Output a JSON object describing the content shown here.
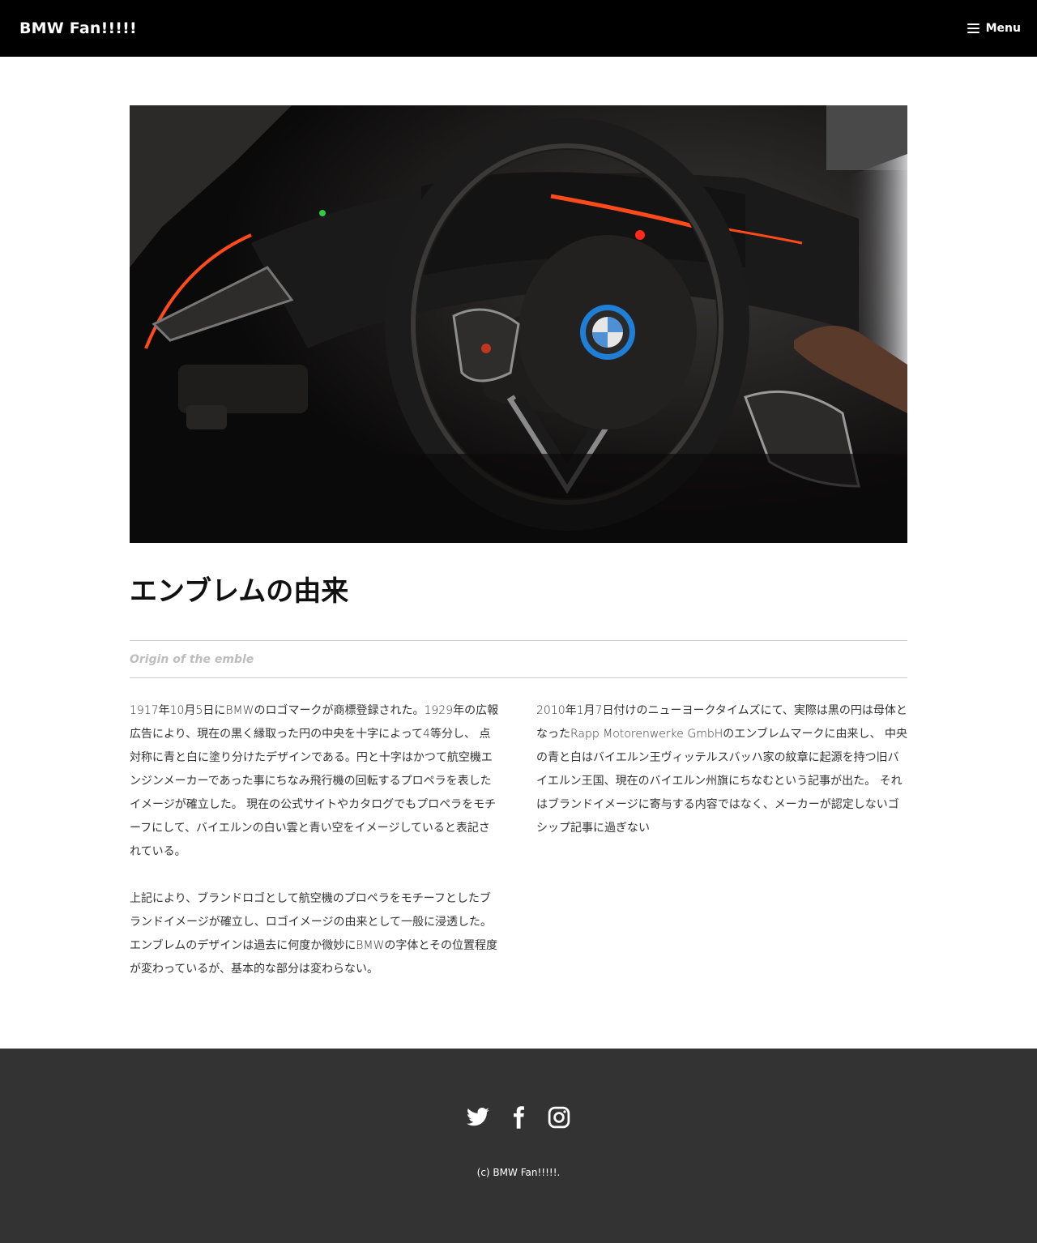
{
  "header": {
    "site_title": "BMW Fan!!!!!",
    "menu_label": "Menu"
  },
  "hero": {
    "alt": "BMW steering wheel interior"
  },
  "article": {
    "title": "エンブレムの由来",
    "subtitle": "Origin of the emble",
    "left_paragraphs": [
      "1917年10月5日にBMWのロゴマークが商標登録された。1929年の広報広告により、現在の黒く縁取った円の中央を十字によって4等分し、 点対称に青と白に塗り分けたデザインである。円と十字はかつて航空機エンジンメーカーであった事にちなみ飛行機の回転するプロペラを表したイメージが確立した。 現在の公式サイトやカタログでもプロペラをモチーフにして、バイエルンの白い雲と青い空をイメージしていると表記されている。",
      "上記により、ブランドロゴとして航空機のプロペラをモチーフとしたブランドイメージが確立し、ロゴイメージの由来として一般に浸透した。 エンブレムのデザインは過去に何度か微妙にBMWの字体とその位置程度が変わっているが、基本的な部分は変わらない。"
    ],
    "right_paragraphs": [
      "2010年1月7日付けのニューヨークタイムズにて、実際は黒の円は母体となったRapp Motorenwerke GmbHのエンブレムマークに由来し、 中央の青と白はバイエルン王ヴィッテルスバッハ家の紋章に起源を持つ旧バイエルン王国、現在のバイエルン州旗にちなむという記事が出た。 それはブランドイメージに寄与する内容ではなく、メーカーが認定しないゴシップ記事に過ぎない"
    ]
  },
  "footer": {
    "social_icons": [
      "twitter-icon",
      "facebook-icon",
      "instagram-icon"
    ],
    "copyright": "(c) BMW Fan!!!!!."
  },
  "colors": {
    "header_bg": "#000000",
    "footer_bg": "#333333",
    "accent_orange": "#ff4a1c",
    "emblem_blue": "#1f7fd6"
  }
}
